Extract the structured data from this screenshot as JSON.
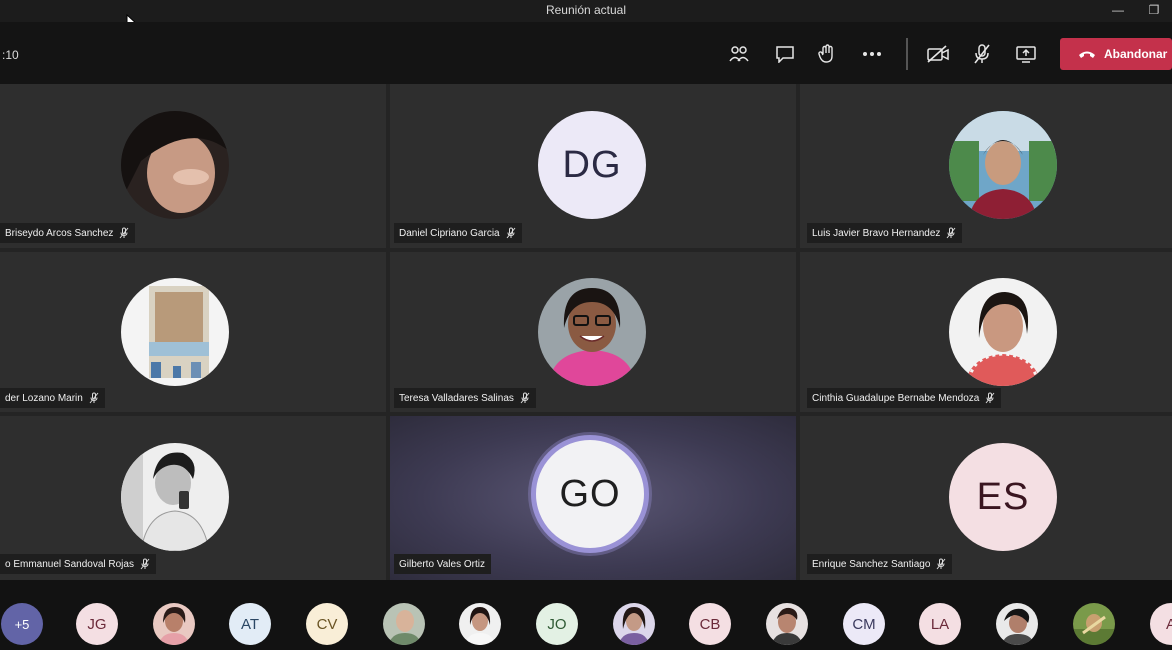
{
  "window": {
    "title": "Reunión actual"
  },
  "toolbar": {
    "timer": ":10",
    "leave_label": "Abandonar"
  },
  "participants": [
    {
      "name": "Briseydo Arcos Sanchez",
      "type": "photo"
    },
    {
      "name": "Daniel Cipriano Garcia",
      "type": "initials",
      "initials": "DG"
    },
    {
      "name": "Luis Javier Bravo Hernandez",
      "type": "photo"
    },
    {
      "name": "der Lozano Marin",
      "type": "photo"
    },
    {
      "name": "Teresa Valladares Salinas",
      "type": "photo"
    },
    {
      "name": "Cinthia Guadalupe Bernabe Mendoza",
      "type": "photo"
    },
    {
      "name": "o Emmanuel Sandoval Rojas",
      "type": "photo"
    },
    {
      "name": "Gilberto Vales Ortiz",
      "type": "initials",
      "initials": "GO",
      "speaking": true
    },
    {
      "name": "Enrique Sanchez Santiago",
      "type": "initials",
      "initials": "ES"
    }
  ],
  "roster": [
    {
      "label": "+5",
      "kind": "more"
    },
    {
      "label": "JG",
      "kind": "pink"
    },
    {
      "label": "",
      "kind": "photo"
    },
    {
      "label": "AT",
      "kind": "blue"
    },
    {
      "label": "CV",
      "kind": "yellow"
    },
    {
      "label": "",
      "kind": "photo"
    },
    {
      "label": "",
      "kind": "photo"
    },
    {
      "label": "JO",
      "kind": "green"
    },
    {
      "label": "",
      "kind": "photo"
    },
    {
      "label": "CB",
      "kind": "pink"
    },
    {
      "label": "",
      "kind": "photo"
    },
    {
      "label": "CM",
      "kind": "ini"
    },
    {
      "label": "LA",
      "kind": "pink"
    },
    {
      "label": "",
      "kind": "photo"
    },
    {
      "label": "",
      "kind": "photo"
    },
    {
      "label": "A",
      "kind": "pink"
    }
  ],
  "colors": {
    "leave": "#c4314b",
    "active_ring": "#9a92d6",
    "more_chip": "#6264a7"
  }
}
